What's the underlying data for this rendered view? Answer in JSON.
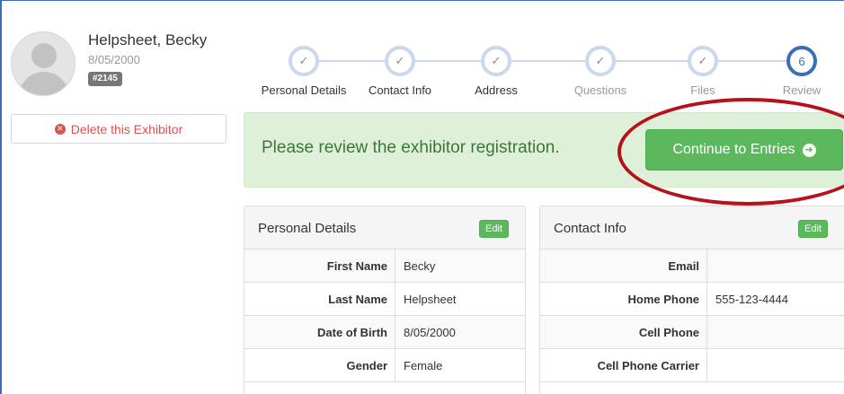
{
  "profile": {
    "name": "Helpsheet, Becky",
    "dob": "8/05/2000",
    "id_badge": "#2145",
    "delete_label": "Delete this Exhibitor"
  },
  "stepper": {
    "steps": [
      {
        "label": "Personal Details",
        "state": "done",
        "mark": "✓"
      },
      {
        "label": "Contact Info",
        "state": "done",
        "mark": "✓"
      },
      {
        "label": "Address",
        "state": "done",
        "mark": "✓"
      },
      {
        "label": "Questions",
        "state": "done",
        "mark": "✓"
      },
      {
        "label": "Files",
        "state": "done",
        "mark": "✓"
      },
      {
        "label": "Review",
        "state": "active",
        "mark": "6"
      }
    ]
  },
  "alert": {
    "message": "Please review the exhibitor registration.",
    "continue_label": "Continue to Entries"
  },
  "personal": {
    "title": "Personal Details",
    "edit_label": "Edit",
    "rows": [
      {
        "label": "First Name",
        "value": "Becky"
      },
      {
        "label": "Last Name",
        "value": "Helpsheet"
      },
      {
        "label": "Date of Birth",
        "value": "8/05/2000"
      },
      {
        "label": "Gender",
        "value": "Female"
      }
    ]
  },
  "contact": {
    "title": "Contact Info",
    "edit_label": "Edit",
    "rows": [
      {
        "label": "Email",
        "value": ""
      },
      {
        "label": "Home Phone",
        "value": "555-123-4444"
      },
      {
        "label": "Cell Phone",
        "value": ""
      },
      {
        "label": "Cell Phone Carrier",
        "value": ""
      }
    ]
  },
  "colors": {
    "success": "#5cb85c",
    "danger": "#d9534f",
    "active_step": "#3a6fb8",
    "annotation": "#b5121b"
  }
}
